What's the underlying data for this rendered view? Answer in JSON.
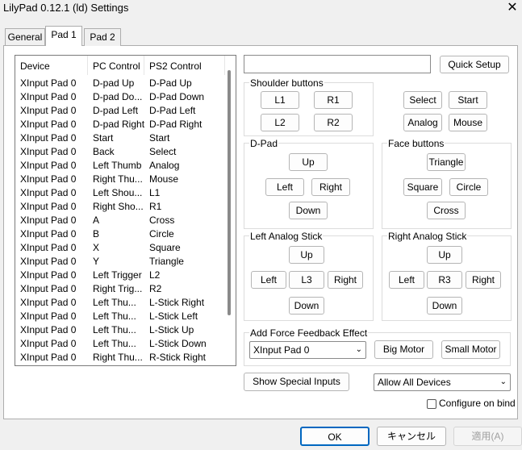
{
  "window": {
    "title": "LilyPad 0.12.1 (ld) Settings",
    "close_glyph": "✕"
  },
  "tabs": [
    "General",
    "Pad 1",
    "Pad 2"
  ],
  "list": {
    "headers": [
      "Device",
      "PC Control",
      "PS2 Control"
    ],
    "rows": [
      [
        "XInput Pad 0",
        "D-pad Up",
        "D-Pad Up"
      ],
      [
        "XInput Pad 0",
        "D-pad Do...",
        "D-Pad Down"
      ],
      [
        "XInput Pad 0",
        "D-pad Left",
        "D-Pad Left"
      ],
      [
        "XInput Pad 0",
        "D-pad Right",
        "D-Pad Right"
      ],
      [
        "XInput Pad 0",
        "Start",
        "Start"
      ],
      [
        "XInput Pad 0",
        "Back",
        "Select"
      ],
      [
        "XInput Pad 0",
        "Left Thumb",
        "Analog"
      ],
      [
        "XInput Pad 0",
        "Right Thu...",
        "Mouse"
      ],
      [
        "XInput Pad 0",
        "Left Shou...",
        "L1"
      ],
      [
        "XInput Pad 0",
        "Right Sho...",
        "R1"
      ],
      [
        "XInput Pad 0",
        "A",
        "Cross"
      ],
      [
        "XInput Pad 0",
        "B",
        "Circle"
      ],
      [
        "XInput Pad 0",
        "X",
        "Square"
      ],
      [
        "XInput Pad 0",
        "Y",
        "Triangle"
      ],
      [
        "XInput Pad 0",
        "Left Trigger",
        "L2"
      ],
      [
        "XInput Pad 0",
        "Right Trig...",
        "R2"
      ],
      [
        "XInput Pad 0",
        "Left Thu...",
        "L-Stick Right"
      ],
      [
        "XInput Pad 0",
        "Left Thu...",
        "L-Stick Left"
      ],
      [
        "XInput Pad 0",
        "Left Thu...",
        "L-Stick Up"
      ],
      [
        "XInput Pad 0",
        "Left Thu...",
        "L-Stick Down"
      ],
      [
        "XInput Pad 0",
        "Right Thu...",
        "R-Stick Right"
      ]
    ]
  },
  "quick_setup": "Quick Setup",
  "shoulder": {
    "title": "Shoulder buttons",
    "l1": "L1",
    "r1": "R1",
    "l2": "L2",
    "r2": "R2"
  },
  "misc": {
    "select": "Select",
    "start": "Start",
    "analog": "Analog",
    "mouse": "Mouse"
  },
  "dpad": {
    "title": "D-Pad",
    "up": "Up",
    "left": "Left",
    "right": "Right",
    "down": "Down"
  },
  "face": {
    "title": "Face buttons",
    "triangle": "Triangle",
    "square": "Square",
    "circle": "Circle",
    "cross": "Cross"
  },
  "lstick": {
    "title": "Left Analog Stick",
    "up": "Up",
    "left": "Left",
    "l3": "L3",
    "right": "Right",
    "down": "Down"
  },
  "rstick": {
    "title": "Right Analog Stick",
    "up": "Up",
    "left": "Left",
    "r3": "R3",
    "right": "Right",
    "down": "Down"
  },
  "ff": {
    "title": "Add Force Feedback Effect",
    "device": "XInput Pad 0",
    "big": "Big Motor",
    "small": "Small Motor"
  },
  "special": "Show Special Inputs",
  "devices": "Allow All Devices",
  "configure_on_bind": "Configure on bind",
  "dialog": {
    "ok": "OK",
    "cancel": "キャンセル",
    "apply": "適用(A)"
  }
}
